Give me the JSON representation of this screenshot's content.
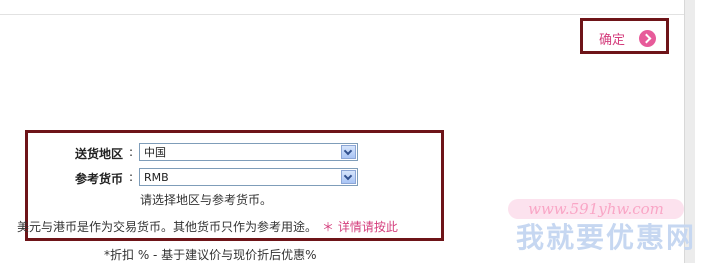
{
  "confirm": {
    "label": "确定"
  },
  "settings": {
    "region": {
      "label": "送货地区",
      "colon": ":",
      "value": "中国"
    },
    "currency": {
      "label": "参考货币",
      "colon": ":",
      "value": "RMB"
    },
    "hint": "请选择地区与参考货币。"
  },
  "notes": {
    "currency_note": "美元与港币是作为交易货币。其他货币只作为参考用途。",
    "detail_link": "＊ 详情请按此",
    "discount_note": "*折扣 % - 基于建议价与现价折后优惠%"
  },
  "watermark": {
    "url": "www.591yhw.com",
    "text": "我就要优惠网"
  },
  "colors": {
    "accent_pink": "#d43d7c",
    "frame_maroon": "#6e1418",
    "select_border": "#7f9db9"
  }
}
